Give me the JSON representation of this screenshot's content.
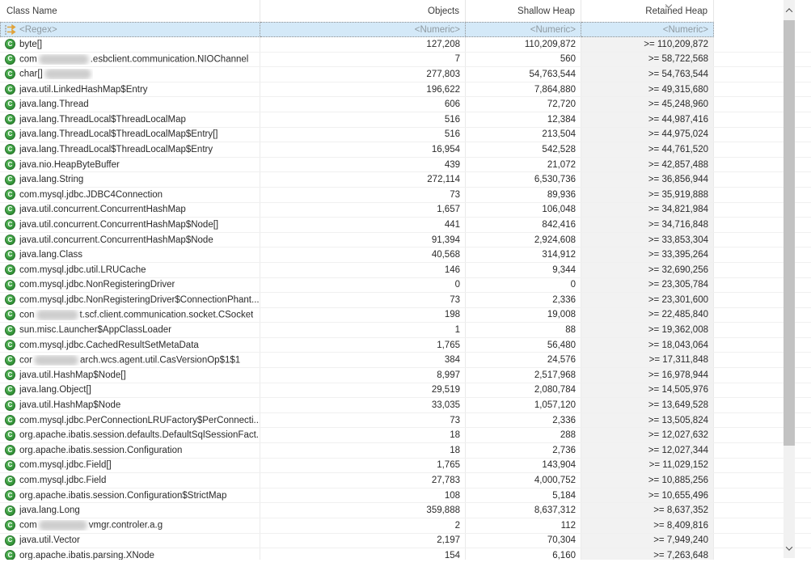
{
  "table": {
    "columns": [
      {
        "label": "Class Name",
        "align": "left"
      },
      {
        "label": "Objects",
        "align": "right"
      },
      {
        "label": "Shallow Heap",
        "align": "right"
      },
      {
        "label": "Retained Heap",
        "align": "right"
      }
    ],
    "sort": {
      "column": "Retained Heap",
      "direction": "descending"
    },
    "filter_row": {
      "class_name": "<Regex>",
      "objects": "<Numeric>",
      "shallow_heap": "<Numeric>",
      "retained_heap": "<Numeric>"
    },
    "rows": [
      {
        "name": [
          {
            "t": "byte[]"
          }
        ],
        "objects": "127,208",
        "shallow_heap": "110,209,872",
        "retained_heap": ">= 110,209,872"
      },
      {
        "name": [
          {
            "t": "com"
          },
          {
            "blur": 62
          },
          {
            "t": ".esbclient.communication.NIOChannel"
          }
        ],
        "objects": "7",
        "shallow_heap": "560",
        "retained_heap": ">= 58,722,568"
      },
      {
        "name": [
          {
            "t": "char[]"
          },
          {
            "blur": 58
          }
        ],
        "objects": "277,803",
        "shallow_heap": "54,763,544",
        "retained_heap": ">= 54,763,544"
      },
      {
        "name": [
          {
            "t": "java.util.LinkedHashMap$Entry"
          }
        ],
        "objects": "196,622",
        "shallow_heap": "7,864,880",
        "retained_heap": ">= 49,315,680"
      },
      {
        "name": [
          {
            "t": "java.lang.Thread"
          }
        ],
        "objects": "606",
        "shallow_heap": "72,720",
        "retained_heap": ">= 45,248,960"
      },
      {
        "name": [
          {
            "t": "java.lang.ThreadLocal$ThreadLocalMap"
          }
        ],
        "objects": "516",
        "shallow_heap": "12,384",
        "retained_heap": ">= 44,987,416"
      },
      {
        "name": [
          {
            "t": "java.lang.ThreadLocal$ThreadLocalMap$Entry[]"
          }
        ],
        "objects": "516",
        "shallow_heap": "213,504",
        "retained_heap": ">= 44,975,024"
      },
      {
        "name": [
          {
            "t": "java.lang.ThreadLocal$ThreadLocalMap$Entry"
          }
        ],
        "objects": "16,954",
        "shallow_heap": "542,528",
        "retained_heap": ">= 44,761,520"
      },
      {
        "name": [
          {
            "t": "java.nio.HeapByteBuffer"
          }
        ],
        "objects": "439",
        "shallow_heap": "21,072",
        "retained_heap": ">= 42,857,488"
      },
      {
        "name": [
          {
            "t": "java.lang.String"
          }
        ],
        "objects": "272,114",
        "shallow_heap": "6,530,736",
        "retained_heap": ">= 36,856,944"
      },
      {
        "name": [
          {
            "t": "com.mysql.jdbc.JDBC4Connection"
          }
        ],
        "objects": "73",
        "shallow_heap": "89,936",
        "retained_heap": ">= 35,919,888"
      },
      {
        "name": [
          {
            "t": "java.util.concurrent.ConcurrentHashMap"
          }
        ],
        "objects": "1,657",
        "shallow_heap": "106,048",
        "retained_heap": ">= 34,821,984"
      },
      {
        "name": [
          {
            "t": "java.util.concurrent.ConcurrentHashMap$Node[]"
          }
        ],
        "objects": "441",
        "shallow_heap": "842,416",
        "retained_heap": ">= 34,716,848"
      },
      {
        "name": [
          {
            "t": "java.util.concurrent.ConcurrentHashMap$Node"
          }
        ],
        "objects": "91,394",
        "shallow_heap": "2,924,608",
        "retained_heap": ">= 33,853,304"
      },
      {
        "name": [
          {
            "t": "java.lang.Class"
          }
        ],
        "objects": "40,568",
        "shallow_heap": "314,912",
        "retained_heap": ">= 33,395,264"
      },
      {
        "name": [
          {
            "t": "com.mysql.jdbc.util.LRUCache"
          }
        ],
        "objects": "146",
        "shallow_heap": "9,344",
        "retained_heap": ">= 32,690,256"
      },
      {
        "name": [
          {
            "t": "com.mysql.jdbc.NonRegisteringDriver"
          }
        ],
        "objects": "0",
        "shallow_heap": "0",
        "retained_heap": ">= 23,305,784"
      },
      {
        "name": [
          {
            "t": "com.mysql.jdbc.NonRegisteringDriver$ConnectionPhant..."
          }
        ],
        "objects": "73",
        "shallow_heap": "2,336",
        "retained_heap": ">= 23,301,600"
      },
      {
        "name": [
          {
            "t": "con"
          },
          {
            "blur": 52
          },
          {
            "t": "t.scf.client.communication.socket.CSocket"
          }
        ],
        "objects": "198",
        "shallow_heap": "19,008",
        "retained_heap": ">= 22,485,840"
      },
      {
        "name": [
          {
            "t": "sun.misc.Launcher$AppClassLoader"
          }
        ],
        "objects": "1",
        "shallow_heap": "88",
        "retained_heap": ">= 19,362,008"
      },
      {
        "name": [
          {
            "t": "com.mysql.jdbc.CachedResultSetMetaData"
          }
        ],
        "objects": "1,765",
        "shallow_heap": "56,480",
        "retained_heap": ">= 18,043,064"
      },
      {
        "name": [
          {
            "t": "cor"
          },
          {
            "blur": 55
          },
          {
            "t": "arch.wcs.agent.util.CasVersionOp$1$1"
          }
        ],
        "objects": "384",
        "shallow_heap": "24,576",
        "retained_heap": ">= 17,311,848"
      },
      {
        "name": [
          {
            "t": "java.util.HashMap$Node[]"
          }
        ],
        "objects": "8,997",
        "shallow_heap": "2,517,968",
        "retained_heap": ">= 16,978,944"
      },
      {
        "name": [
          {
            "t": "java.lang.Object[]"
          }
        ],
        "objects": "29,519",
        "shallow_heap": "2,080,784",
        "retained_heap": ">= 14,505,976"
      },
      {
        "name": [
          {
            "t": "java.util.HashMap$Node"
          }
        ],
        "objects": "33,035",
        "shallow_heap": "1,057,120",
        "retained_heap": ">= 13,649,528"
      },
      {
        "name": [
          {
            "t": "com.mysql.jdbc.PerConnectionLRUFactory$PerConnecti..."
          }
        ],
        "objects": "73",
        "shallow_heap": "2,336",
        "retained_heap": ">= 13,505,824"
      },
      {
        "name": [
          {
            "t": "org.apache.ibatis.session.defaults.DefaultSqlSessionFact..."
          }
        ],
        "objects": "18",
        "shallow_heap": "288",
        "retained_heap": ">= 12,027,632"
      },
      {
        "name": [
          {
            "t": "org.apache.ibatis.session.Configuration"
          }
        ],
        "objects": "18",
        "shallow_heap": "2,736",
        "retained_heap": ">= 12,027,344"
      },
      {
        "name": [
          {
            "t": "com.mysql.jdbc.Field[]"
          }
        ],
        "objects": "1,765",
        "shallow_heap": "143,904",
        "retained_heap": ">= 11,029,152"
      },
      {
        "name": [
          {
            "t": "com.mysql.jdbc.Field"
          }
        ],
        "objects": "27,783",
        "shallow_heap": "4,000,752",
        "retained_heap": ">= 10,885,256"
      },
      {
        "name": [
          {
            "t": "org.apache.ibatis.session.Configuration$StrictMap"
          }
        ],
        "objects": "108",
        "shallow_heap": "5,184",
        "retained_heap": ">= 10,655,496"
      },
      {
        "name": [
          {
            "t": "java.lang.Long"
          }
        ],
        "objects": "359,888",
        "shallow_heap": "8,637,312",
        "retained_heap": ">= 8,637,352"
      },
      {
        "name": [
          {
            "t": "com"
          },
          {
            "blur": 60
          },
          {
            "t": "vmgr.controler.a.g"
          }
        ],
        "objects": "2",
        "shallow_heap": "112",
        "retained_heap": ">= 8,409,816"
      },
      {
        "name": [
          {
            "t": "java.util.Vector"
          }
        ],
        "objects": "2,197",
        "shallow_heap": "70,304",
        "retained_heap": ">= 7,949,240"
      },
      {
        "name": [
          {
            "t": "org.apache.ibatis.parsing.XNode"
          }
        ],
        "objects": "154",
        "shallow_heap": "6,160",
        "retained_heap": ">= 7,263,648"
      }
    ]
  },
  "icons": {
    "class_icon_letter": "C",
    "filter_icon": "regex-filter",
    "sort_icon": "chevron-down",
    "scroll_up_icon": "chevron-up",
    "scroll_down_icon": "chevron-down"
  },
  "colors": {
    "filter_row_bg": "#d4e9f8",
    "sorted_column_bg": "#f2f2f2",
    "class_icon_green": "#2f8f34",
    "scroll_thumb": "#c2c2c2",
    "grid_line": "#eaeaea"
  }
}
